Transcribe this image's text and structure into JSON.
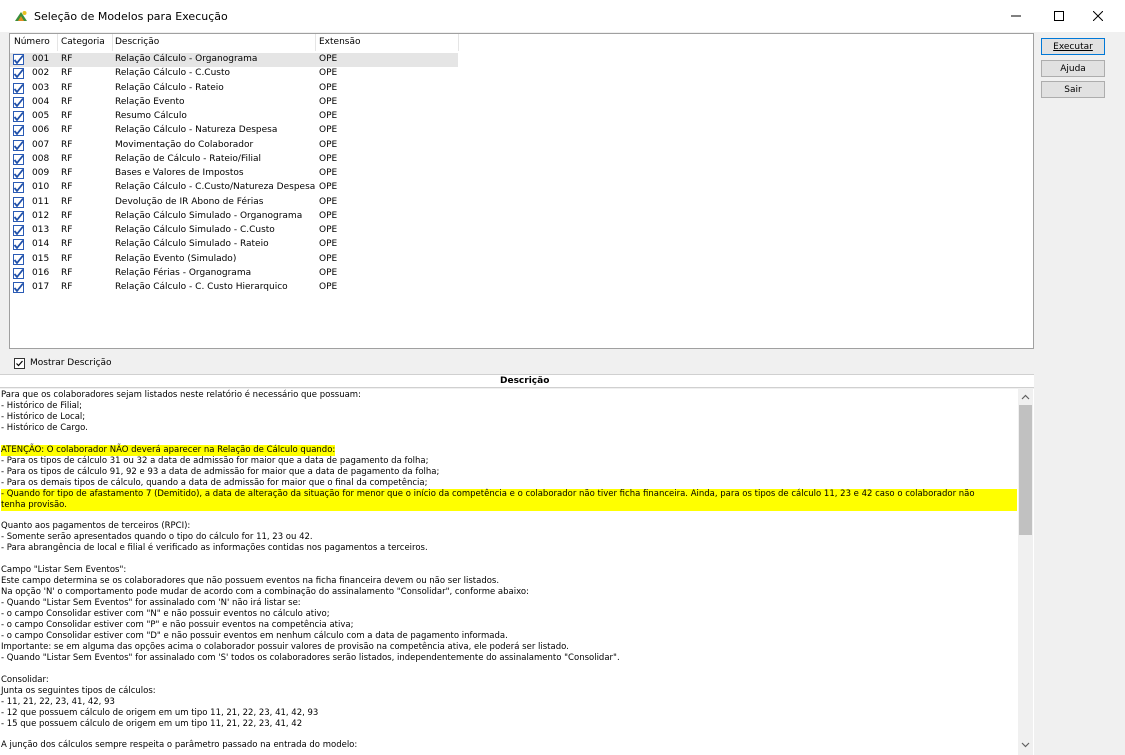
{
  "window": {
    "title": "Seleção de Modelos para Execução"
  },
  "list": {
    "columns": [
      "Número",
      "Categoria",
      "Descrição",
      "Extensão"
    ],
    "rows": [
      {
        "num": "001",
        "cat": "RF",
        "desc": "Relação Cálculo - Organograma",
        "ext": "OPE"
      },
      {
        "num": "002",
        "cat": "RF",
        "desc": "Relação Cálculo - C.Custo",
        "ext": "OPE"
      },
      {
        "num": "003",
        "cat": "RF",
        "desc": "Relação Cálculo - Rateio",
        "ext": "OPE"
      },
      {
        "num": "004",
        "cat": "RF",
        "desc": "Relação Evento",
        "ext": "OPE"
      },
      {
        "num": "005",
        "cat": "RF",
        "desc": "Resumo Cálculo",
        "ext": "OPE"
      },
      {
        "num": "006",
        "cat": "RF",
        "desc": "Relação Cálculo - Natureza Despesa",
        "ext": "OPE"
      },
      {
        "num": "007",
        "cat": "RF",
        "desc": "Movimentação do Colaborador",
        "ext": "OPE"
      },
      {
        "num": "008",
        "cat": "RF",
        "desc": "Relação de Cálculo - Rateio/Filial",
        "ext": "OPE"
      },
      {
        "num": "009",
        "cat": "RF",
        "desc": "Bases e Valores de Impostos",
        "ext": "OPE"
      },
      {
        "num": "010",
        "cat": "RF",
        "desc": "Relação Cálculo - C.Custo/Natureza Despesa",
        "ext": "OPE"
      },
      {
        "num": "011",
        "cat": "RF",
        "desc": "Devolução de IR Abono de Férias",
        "ext": "OPE"
      },
      {
        "num": "012",
        "cat": "RF",
        "desc": "Relação Cálculo Simulado - Organograma",
        "ext": "OPE"
      },
      {
        "num": "013",
        "cat": "RF",
        "desc": "Relação Cálculo Simulado - C.Custo",
        "ext": "OPE"
      },
      {
        "num": "014",
        "cat": "RF",
        "desc": "Relação Cálculo Simulado - Rateio",
        "ext": "OPE"
      },
      {
        "num": "015",
        "cat": "RF",
        "desc": "Relação Evento (Simulado)",
        "ext": "OPE"
      },
      {
        "num": "016",
        "cat": "RF",
        "desc": "Relação Férias - Organograma",
        "ext": "OPE"
      },
      {
        "num": "017",
        "cat": "RF",
        "desc": "Relação Cálculo - C. Custo Hierarquico",
        "ext": "OPE"
      }
    ]
  },
  "buttons": {
    "executar": "Executar",
    "ajuda": "Ajuda",
    "sair": "Sair"
  },
  "mostrar_descricao": "Mostrar Descrição",
  "descricao_header": "Descrição",
  "description_lines": [
    {
      "t": "Para que os colaboradores sejam listados neste relatório é necessário que possuam:"
    },
    {
      "t": "- Histórico de Filial;"
    },
    {
      "t": "- Histórico de Local;"
    },
    {
      "t": "- Histórico de Cargo."
    },
    {
      "t": ""
    },
    {
      "t": "ATENÇÃO: O colaborador NÃO deverá aparecer na Relação de Cálculo quando:",
      "hl": "short"
    },
    {
      "t": "- Para os tipos de cálculo 31 ou 32 a data de admissão for maior que a data de pagamento da folha;"
    },
    {
      "t": "- Para os tipos de cálculo 91, 92 e 93 a data de admissão for maior que a data de pagamento da folha;"
    },
    {
      "t": "- Para os demais tipos de cálculo, quando a data de admissão for maior que o final da competência;"
    },
    {
      "t": "- Quando for tipo de afastamento 7 (Demitido), a data de alteração da situação for menor que o início da competência e o colaborador não tiver ficha financeira. Ainda, para os tipos de cálculo 11, 23 e 42 caso o colaborador não",
      "hl": "full"
    },
    {
      "t": "tenha provisão.",
      "hl": "full"
    },
    {
      "t": ""
    },
    {
      "t": "Quanto aos pagamentos de terceiros (RPCI):"
    },
    {
      "t": "- Somente serão apresentados quando o tipo do cálculo for 11, 23 ou 42."
    },
    {
      "t": "- Para abrangência de local e filial é verificado as informações contidas nos pagamentos a terceiros."
    },
    {
      "t": ""
    },
    {
      "t": "Campo \"Listar Sem Eventos\":"
    },
    {
      "t": "Este campo determina se os colaboradores que não possuem eventos na ficha financeira devem ou não ser listados."
    },
    {
      "t": "Na opção 'N' o comportamento pode mudar de acordo com a combinação do assinalamento \"Consolidar\", conforme abaixo:"
    },
    {
      "t": "- Quando \"Listar Sem Eventos\" for assinalado com 'N' não irá listar se:"
    },
    {
      "t": "  - o campo Consolidar estiver com \"N\" e não possuir eventos no cálculo ativo;"
    },
    {
      "t": "  - o campo Consolidar estiver com \"P\" e não possuir eventos na competência ativa;"
    },
    {
      "t": "  - o campo Consolidar estiver com \"D\" e não possuir eventos em nenhum cálculo com a data de pagamento informada."
    },
    {
      "t": "  Importante: se em alguma das opções acima o colaborador possuir valores de provisão na competência ativa, ele poderá ser listado."
    },
    {
      "t": "- Quando \"Listar Sem Eventos\" for assinalado com 'S' todos os colaboradores serão listados, independentemente do assinalamento \"Consolidar\"."
    },
    {
      "t": ""
    },
    {
      "t": "Consolidar:"
    },
    {
      "t": "Junta os seguintes tipos de cálculos:"
    },
    {
      "t": "- 11, 21, 22, 23, 41, 42, 93"
    },
    {
      "t": "- 12 que possuem cálculo de origem em um tipo 11, 21, 22, 23, 41, 42, 93"
    },
    {
      "t": "- 15 que possuem cálculo de origem em um tipo 11, 21, 22, 23, 41, 42"
    },
    {
      "t": ""
    },
    {
      "t": "A junção dos cálculos sempre respeita o parâmetro passado na entrada do modelo:"
    }
  ]
}
